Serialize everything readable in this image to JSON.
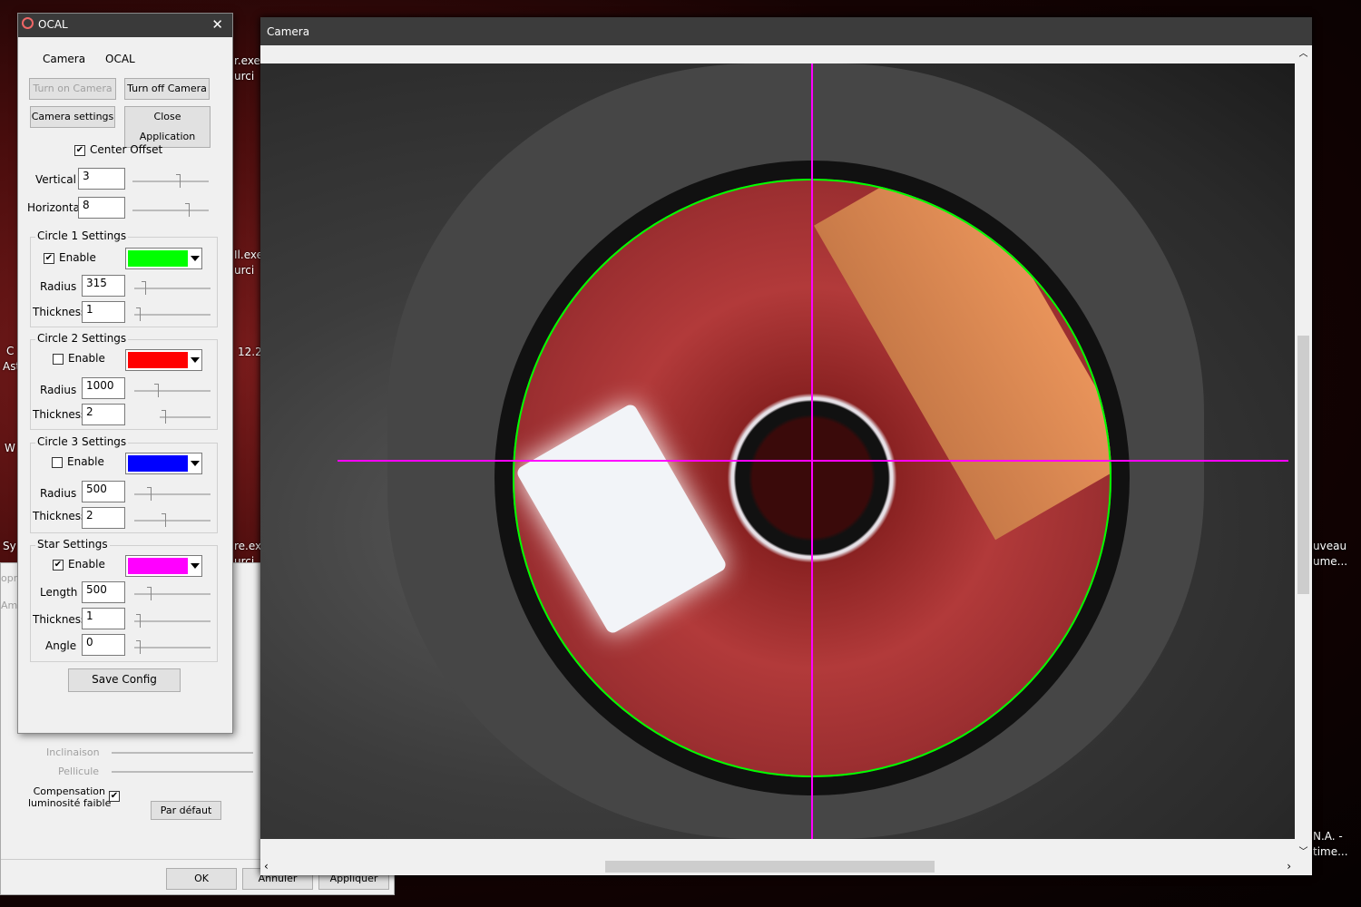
{
  "desktop": {
    "labels": [
      "r.exe",
      "urci",
      "Il.exe",
      "urci",
      "12.2",
      "re.exe",
      "urci",
      "uveau",
      "ume...",
      "N.A. -",
      "time...",
      "C",
      "Ast",
      "W",
      "Sy",
      "opr",
      "Amp"
    ]
  },
  "bg_dialog": {
    "inclinaison": "Inclinaison",
    "pellicule": "Pellicule",
    "compensation": "Compensation\nluminosité faible",
    "compensation_checked": true,
    "default_button": "Par défaut",
    "ok": "OK",
    "cancel": "Annuler",
    "apply": "Appliquer"
  },
  "camera_window": {
    "title": "Camera"
  },
  "overlay": {
    "circle1_color": "#00ff00",
    "star_color": "#ff00ff"
  },
  "ocal": {
    "title": "OCAL",
    "menu": [
      "Camera",
      "OCAL"
    ],
    "buttons": {
      "turn_on": "Turn on Camera",
      "turn_off": "Turn off Camera",
      "settings": "Camera settings",
      "close": "Close Application",
      "save": "Save Config"
    },
    "center_offset": {
      "label": "Center Offset",
      "checked": true,
      "vertical_label": "Vertical",
      "vertical": "3",
      "horizontal_label": "Horizontal",
      "horizontal": "8"
    },
    "circle1": {
      "title": "Circle 1 Settings",
      "enable": "Enable",
      "enabled": true,
      "color": "#00ff00",
      "radius_label": "Radius",
      "radius": "315",
      "thickness_label": "Thickness",
      "thickness": "1"
    },
    "circle2": {
      "title": "Circle 2 Settings",
      "enable": "Enable",
      "enabled": false,
      "color": "#ff0000",
      "radius_label": "Radius",
      "radius": "1000",
      "thickness_label": "Thickness",
      "thickness": "2"
    },
    "circle3": {
      "title": "Circle 3 Settings",
      "enable": "Enable",
      "enabled": false,
      "color": "#0000ff",
      "radius_label": "Radius",
      "radius": "500",
      "thickness_label": "Thickness",
      "thickness": "2"
    },
    "star": {
      "title": "Star Settings",
      "enable": "Enable",
      "enabled": true,
      "color": "#ff00ff",
      "length_label": "Length",
      "length": "500",
      "thickness_label": "Thickness",
      "thickness": "1",
      "angle_label": "Angle",
      "angle": "0"
    }
  }
}
